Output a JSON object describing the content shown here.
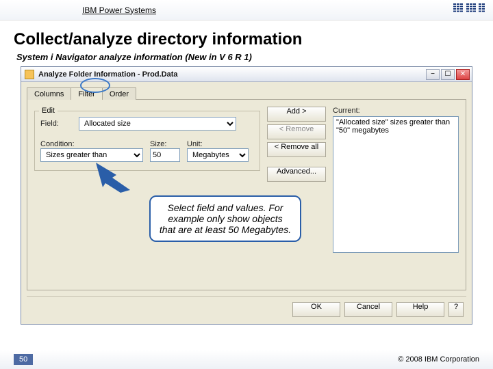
{
  "topbar": {
    "brand": "IBM Power Systems"
  },
  "heading": "Collect/analyze directory information",
  "subheading": "System i Navigator analyze information (New in V 6 R 1)",
  "window": {
    "title": "Analyze Folder Information - Prod.Data",
    "tabs": {
      "columns": "Columns",
      "filter": "Filter",
      "order": "Order"
    },
    "edit_legend": "Edit",
    "labels": {
      "field": "Field:",
      "condition": "Condition:",
      "size": "Size:",
      "unit": "Unit:",
      "current": "Current:"
    },
    "values": {
      "field": "Allocated size",
      "condition": "Sizes greater than",
      "size": "50",
      "unit": "Megabytes"
    },
    "buttons": {
      "add": "Add >",
      "remove": "< Remove",
      "remove_all": "< Remove all",
      "advanced": "Advanced..."
    },
    "current_item": "\"Allocated size\" sizes greater than \"50\" megabytes",
    "dlg": {
      "ok": "OK",
      "cancel": "Cancel",
      "help": "Help",
      "q": "?"
    }
  },
  "callout": "Select field and values. For example only show objects that are at least 50 Megabytes.",
  "footer": {
    "page": "50",
    "copyright": "© 2008 IBM Corporation"
  }
}
